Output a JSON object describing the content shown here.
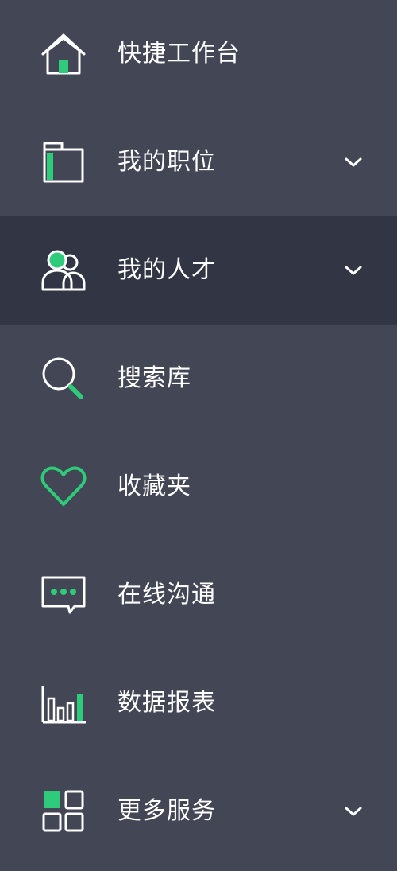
{
  "colors": {
    "background": "#434655",
    "active_background": "#323644",
    "accent": "#2ecc7a",
    "text": "#ffffff"
  },
  "menu": {
    "items": [
      {
        "label": "快捷工作台",
        "icon": "home-icon",
        "expandable": false
      },
      {
        "label": "我的职位",
        "icon": "folder-icon",
        "expandable": true
      },
      {
        "label": "我的人才",
        "icon": "users-icon",
        "expandable": true,
        "active": true
      },
      {
        "label": "搜索库",
        "icon": "search-icon",
        "expandable": false
      },
      {
        "label": "收藏夹",
        "icon": "heart-icon",
        "expandable": false
      },
      {
        "label": "在线沟通",
        "icon": "chat-icon",
        "expandable": false
      },
      {
        "label": "数据报表",
        "icon": "bar-chart-icon",
        "expandable": false
      },
      {
        "label": "更多服务",
        "icon": "grid-icon",
        "expandable": true
      }
    ]
  }
}
